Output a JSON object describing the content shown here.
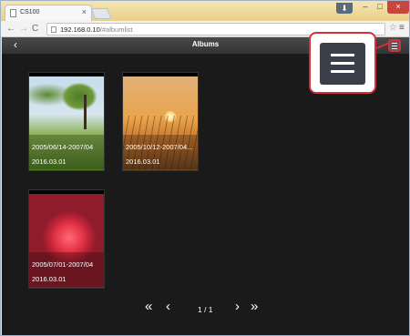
{
  "browser": {
    "tab_title": "CS100",
    "tab_close": "×",
    "window_controls": {
      "user": "⬇",
      "minimize": "–",
      "maximize": "□",
      "close": "×"
    },
    "nav": {
      "back": "←",
      "forward": "→",
      "reload": "C"
    },
    "url_host": "192.168.0.10",
    "url_path": "/#albumlist",
    "star": "☆",
    "menu": "≡"
  },
  "app": {
    "back_label": "‹",
    "title": "Albums",
    "menu_icon": "hamburger-menu-icon"
  },
  "albums": [
    {
      "range": "2005/06/14-2007/04",
      "date": "2016.03.01"
    },
    {
      "range": "2005/10/12-2007/04...",
      "date": "2016.03.01"
    },
    {
      "range": "2005/07/01-2007/04",
      "date": "2016.03.01"
    }
  ],
  "pager": {
    "first": "«",
    "prev": "‹",
    "page": "1 / 1",
    "next": "›",
    "last": "»"
  },
  "colors": {
    "accent": "#d62f3b",
    "background": "#1a1a1a",
    "header": "#3d3d3d"
  }
}
